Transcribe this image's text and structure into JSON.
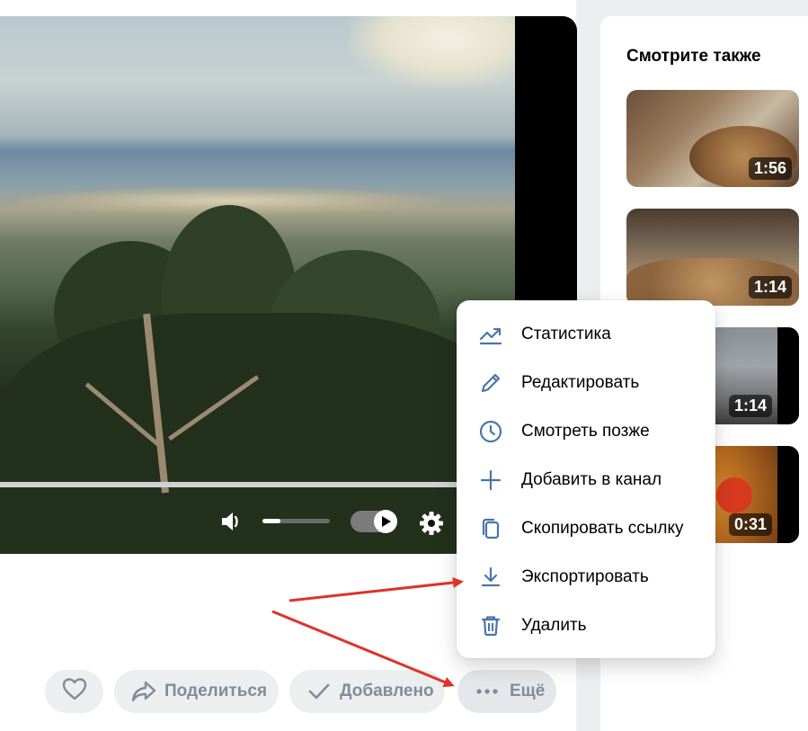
{
  "sidebar": {
    "title": "Смотрите также",
    "videos": [
      {
        "duration": "1:56"
      },
      {
        "duration": "1:14"
      },
      {
        "duration": "1:14"
      },
      {
        "duration": "0:31"
      }
    ]
  },
  "player": {
    "icons": [
      "volume-icon",
      "play-icon",
      "settings-gear-icon"
    ],
    "volume_level": 0.27,
    "autoplay_on": true
  },
  "context_menu": {
    "items": [
      {
        "label": "Статистика",
        "icon": "statistics-icon"
      },
      {
        "label": "Редактировать",
        "icon": "pencil-icon"
      },
      {
        "label": "Смотреть позже",
        "icon": "clock-icon"
      },
      {
        "label": "Добавить в канал",
        "icon": "plus-icon"
      },
      {
        "label": "Скопировать ссылку",
        "icon": "copy-icon"
      },
      {
        "label": "Экспортировать",
        "icon": "download-icon"
      },
      {
        "label": "Удалить",
        "icon": "trash-icon"
      }
    ]
  },
  "actions": {
    "like_icon": "heart-icon",
    "share_label": "Поделиться",
    "added_label": "Добавлено",
    "more_label": "Ещё"
  },
  "colors": {
    "accent": "#2a5885",
    "icon_blue": "#4a76a8",
    "button_bg": "#edeef0",
    "button_text": "#818c99",
    "annotation_arrow": "#e0322a"
  }
}
